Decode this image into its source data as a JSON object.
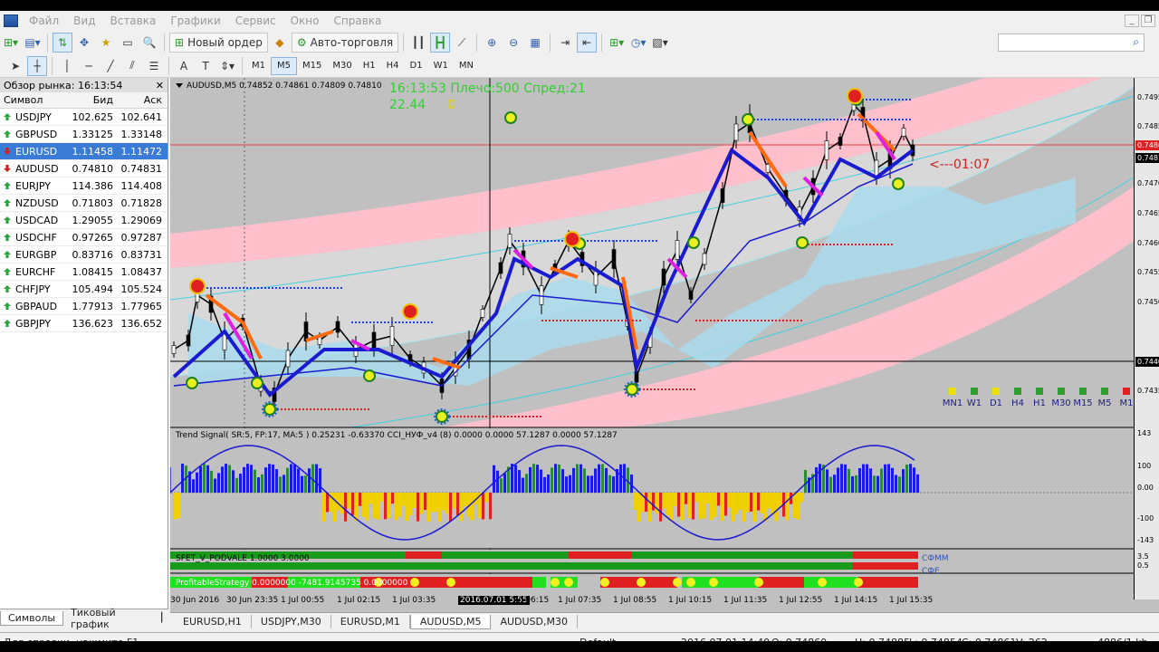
{
  "menu": [
    "Файл",
    "Вид",
    "Вставка",
    "Графики",
    "Сервис",
    "Окно",
    "Справка"
  ],
  "toolbar": {
    "new_order": "Новый ордер",
    "auto_trading": "Авто-торговля",
    "timeframes": [
      "M1",
      "M5",
      "M15",
      "M30",
      "H1",
      "H4",
      "D1",
      "W1",
      "MN"
    ],
    "active_timeframe": "M5"
  },
  "market_watch": {
    "title": "Обзор рынка: 16:13:54",
    "col_symbol": "Символ",
    "col_bid": "Бид",
    "col_ask": "Аск",
    "rows": [
      {
        "symbol": "USDJPY",
        "bid": "102.625",
        "ask": "102.641",
        "dir": "up"
      },
      {
        "symbol": "GBPUSD",
        "bid": "1.33125",
        "ask": "1.33148",
        "dir": "up"
      },
      {
        "symbol": "EURUSD",
        "bid": "1.11458",
        "ask": "1.11472",
        "dir": "dn"
      },
      {
        "symbol": "AUDUSD",
        "bid": "0.74810",
        "ask": "0.74831",
        "dir": "dn"
      },
      {
        "symbol": "EURJPY",
        "bid": "114.386",
        "ask": "114.408",
        "dir": "up"
      },
      {
        "symbol": "NZDUSD",
        "bid": "0.71803",
        "ask": "0.71828",
        "dir": "up"
      },
      {
        "symbol": "USDCAD",
        "bid": "1.29055",
        "ask": "1.29069",
        "dir": "up"
      },
      {
        "symbol": "USDCHF",
        "bid": "0.97265",
        "ask": "0.97287",
        "dir": "up"
      },
      {
        "symbol": "EURGBP",
        "bid": "0.83716",
        "ask": "0.83731",
        "dir": "up"
      },
      {
        "symbol": "EURCHF",
        "bid": "1.08415",
        "ask": "1.08437",
        "dir": "up"
      },
      {
        "symbol": "CHFJPY",
        "bid": "105.494",
        "ask": "105.524",
        "dir": "up"
      },
      {
        "symbol": "GBPAUD",
        "bid": "1.77913",
        "ask": "1.77965",
        "dir": "up"
      },
      {
        "symbol": "GBPJPY",
        "bid": "136.623",
        "ask": "136.652",
        "dir": "up"
      }
    ],
    "tab_symbols": "Символы",
    "tab_tick": "Тиковый график"
  },
  "chart": {
    "ohlc": "AUDUSD,M5  0.74852 0.74861 0.74809 0.74810",
    "info_line1": "16:13:53 Плечо:500 Спред:21",
    "info_line2": "22.44",
    "info_line2b": "0",
    "timer": "<---01:07",
    "ind1_label": "Trend Signal( SR:5, FP:17, MA:5 )  0.25231 -0.63370   CCI_НУФ_v4 (8) 0.0000 0.0000 57.1287 0.0000 57.1287",
    "ind2_label": "SFET_V_PODVALE 1.0000 3.0000",
    "ind2_tag1": "СФММ",
    "ind2_tag2": "СФЕ",
    "ind3_label": "ProfitableStrategy 0.0000000 -7481.9145735 0.0000000",
    "mtf_labels": [
      "MN1",
      "W1",
      "D1",
      "H4",
      "H1",
      "M30",
      "M15",
      "M5",
      "M1"
    ],
    "mtf_colors": [
      "#e8e000",
      "#2e9e2e",
      "#e8e000",
      "#2e9e2e",
      "#2e9e2e",
      "#2e9e2e",
      "#2e9e2e",
      "#2e9e2e",
      "#e02020"
    ],
    "price_labels": [
      "0.7495",
      "0.7485",
      "0.7470",
      "0.7465",
      "0.7460",
      "0.7455",
      "0.7450",
      "0.7445",
      "0.7440",
      "0.7435"
    ],
    "current_price": "0.74810",
    "cross_price": "0.74400",
    "red_price": "0.74860",
    "ind1_scale": [
      "143",
      "100",
      "0.00",
      "-100",
      "-143"
    ],
    "ind2_scale": [
      "3.5",
      "0.5"
    ],
    "time_labels": [
      "30 Jun 2016",
      "30 Jun 23:35",
      "1 Jul 00:55",
      "1 Jul 02:15",
      "1 Jul 03:35",
      "2016.07.01 5:55",
      "1 Jul 06:15",
      "1 Jul 07:35",
      "1 Jul 08:55",
      "1 Jul 10:15",
      "1 Jul 11:35",
      "1 Jul 12:55",
      "1 Jul 14:15",
      "1 Jul 15:35"
    ]
  },
  "chart_tabs": [
    "EURUSD,H1",
    "USDJPY,M30",
    "EURUSD,M1",
    "AUDUSD,M5",
    "AUDUSD,M30"
  ],
  "active_chart_tab": "AUDUSD,M5",
  "status": {
    "help": "Для справки, нажмите F1",
    "profile": "Default",
    "time": "2016.07.01 14:40",
    "open": "O: 0.74860",
    "high": "H: 0.74885",
    "low": "L: 0.74854",
    "close": "C: 0.74861",
    "volume": "V: 262",
    "traffic": "4886/1 kb"
  }
}
